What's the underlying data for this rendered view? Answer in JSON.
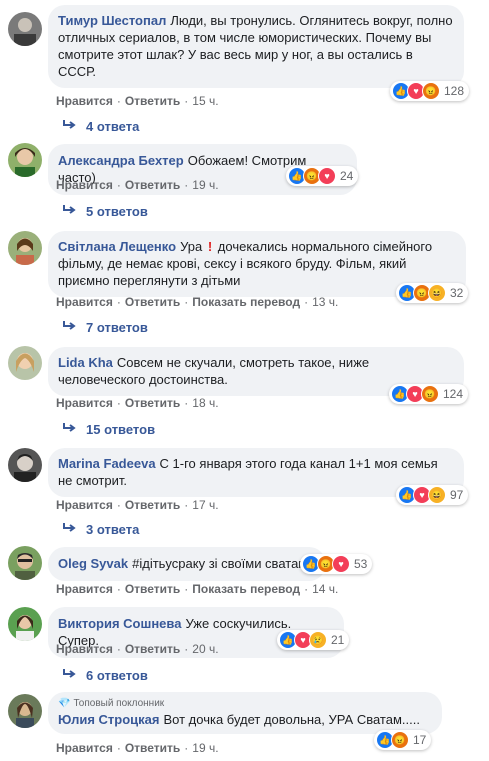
{
  "comments": [
    {
      "author": "Тимур Шестопал",
      "text": "Люди, вы тронулись. Оглянитесь вокруг, полно отличных сериалов, в том числе юмористических. Почему вы смотрите этот шлак? У вас весь мир у ног, а вы остались в СССР.",
      "like": "Нравится",
      "reply": "Ответить",
      "time": "15 ч.",
      "reactions": "128",
      "replies": "4 ответа",
      "reaction_icons": [
        "like",
        "love",
        "angry"
      ]
    },
    {
      "author": "Александра Бехтер",
      "text": "Обожаем! Смотрим часто)",
      "like": "Нравится",
      "reply": "Ответить",
      "time": "19 ч.",
      "reactions": "24",
      "replies": "5 ответов",
      "reaction_icons": [
        "like",
        "angry",
        "love"
      ]
    },
    {
      "author": "Світлана Лещенко",
      "text_pre": "Ура",
      "text_mark": "!",
      "text": "дочекались нормального сімейного фільму, де немає крові, сексу і всякого бруду. Фільм, який приємно переглянути з дітьми",
      "like": "Нравится",
      "reply": "Ответить",
      "translate": "Показать перевод",
      "time": "13 ч.",
      "reactions": "32",
      "replies": "7 ответов",
      "reaction_icons": [
        "like",
        "angry",
        "haha"
      ]
    },
    {
      "author": "Lida Kha",
      "text": "Совсем не скучали, смотреть такое, ниже человеческого достоинства.",
      "like": "Нравится",
      "reply": "Ответить",
      "time": "18 ч.",
      "reactions": "124",
      "replies": "15 ответов",
      "reaction_icons": [
        "like",
        "love",
        "angry"
      ]
    },
    {
      "author": "Marina Fadeeva",
      "text": "С 1-го января этого года канал 1+1 моя семья не смотрит.",
      "like": "Нравится",
      "reply": "Ответить",
      "time": "17 ч.",
      "reactions": "97",
      "replies": "3 ответа",
      "reaction_icons": [
        "like",
        "love",
        "haha"
      ]
    },
    {
      "author": "Oleg Syvak",
      "text": "#ідітьусраку зі своїми сватами",
      "like": "Нравится",
      "reply": "Ответить",
      "translate": "Показать перевод",
      "time": "14 ч.",
      "reactions": "53",
      "reaction_icons": [
        "like",
        "angry",
        "love"
      ]
    },
    {
      "author": "Виктория Сошнева",
      "text": "Уже соскучились. Супер.",
      "like": "Нравится",
      "reply": "Ответить",
      "time": "20 ч.",
      "reactions": "21",
      "replies": "6 ответов",
      "reaction_icons": [
        "like",
        "love",
        "sad"
      ]
    },
    {
      "badge": "Топовый поклонник",
      "author": "Юлия Строцкая",
      "text": "Вот дочка будет довольна, УРА Сватам.....",
      "like": "Нравится",
      "reply": "Ответить",
      "time": "19 ч.",
      "reactions": "17",
      "reaction_icons": [
        "like",
        "angry"
      ]
    }
  ],
  "colors": {
    "link": "#385898",
    "bubble": "#f0f2f5",
    "meta": "#65676b",
    "like": "#1877f2",
    "love": "#f33e58",
    "angry": "#e9710f",
    "haha": "#f7b125"
  }
}
